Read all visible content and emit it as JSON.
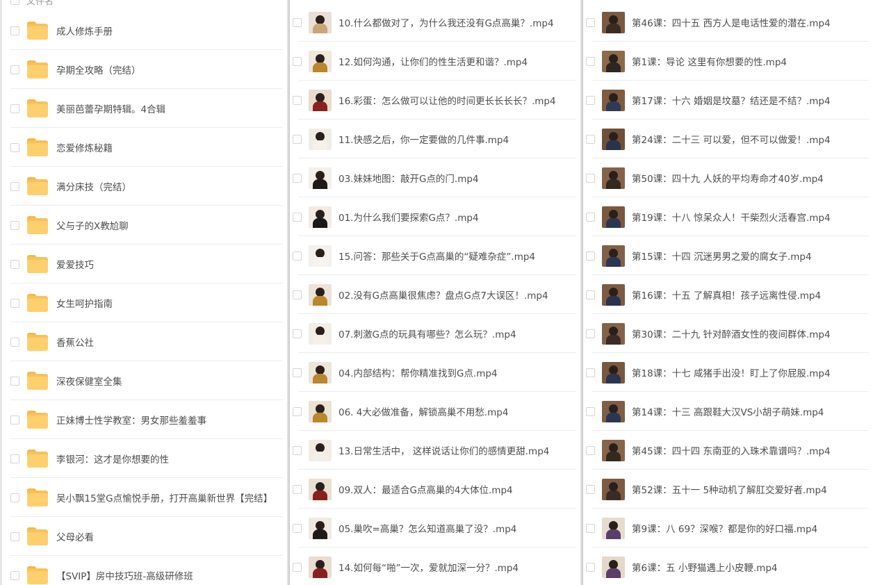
{
  "folders_header": {
    "label": "文件名"
  },
  "folders": [
    {
      "name": "成人修炼手册"
    },
    {
      "name": "孕期全攻略（完结）"
    },
    {
      "name": "美丽芭蕾孕期特辑。4合辑"
    },
    {
      "name": "恋爱修炼秘籍"
    },
    {
      "name": "满分床技（完结）"
    },
    {
      "name": "父与子的X教尬聊"
    },
    {
      "name": "爱爱技巧"
    },
    {
      "name": "女生呵护指南"
    },
    {
      "name": "香蕉公社"
    },
    {
      "name": "深夜保健室全集"
    },
    {
      "name": "正妹博士性学教室：男女那些羞羞事"
    },
    {
      "name": "李银河：这才是你想要的性"
    },
    {
      "name": "吴小飘15堂G点愉悦手册，打开高巢新世界【完结】"
    },
    {
      "name": "父母必看"
    },
    {
      "name": "【SVIP】房中技巧班-高级研修班"
    }
  ],
  "files_middle": [
    {
      "name": "10.什么都做对了，为什么我还没有G点高巢？.mp4",
      "thumb_bg": "#e9dfd6",
      "thumb_shirt": "#c9a57a"
    },
    {
      "name": "12.如何沟通，让你们的性生活更和谐？.mp4",
      "thumb_bg": "#efe6dc",
      "thumb_shirt": "#b8872e"
    },
    {
      "name": "16.彩蛋：怎么做可以让他的时间更长长长长？.mp4",
      "thumb_bg": "#e8dccf",
      "thumb_shirt": "#8a1f1f"
    },
    {
      "name": "11.快感之后，你一定要做的几件事.mp4",
      "thumb_bg": "#f2ece6",
      "thumb_shirt": "#f5f0ea"
    },
    {
      "name": "03.妹妹地图：敲开G点的门.mp4",
      "thumb_bg": "#f3efea",
      "thumb_shirt": "#1f1a17"
    },
    {
      "name": "01.为什么我们要探索G点？.mp4",
      "thumb_bg": "#f1ebe4",
      "thumb_shirt": "#1c1816"
    },
    {
      "name": "15.问答：那些关于G点高巢的“疑难杂症”.mp4",
      "thumb_bg": "#f4f0ec",
      "thumb_shirt": "#f7f3ee"
    },
    {
      "name": "02.没有G点高巢很焦虑？盘点G点7大误区！.mp4",
      "thumb_bg": "#ece3d8",
      "thumb_shirt": "#b8872e"
    },
    {
      "name": "07.刺激G点的玩具有哪些？怎么玩？.mp4",
      "thumb_bg": "#f2ede7",
      "thumb_shirt": "#f5f0ea"
    },
    {
      "name": "04.内部结构：帮你精准找到G点.mp4",
      "thumb_bg": "#ede4da",
      "thumb_shirt": "#b8872e"
    },
    {
      "name": "06. 4大必做准备，解锁高巢不用愁.mp4",
      "thumb_bg": "#ebe1d5",
      "thumb_shirt": "#b8872e"
    },
    {
      "name": "13.日常生活中， 这样说话让你们的感情更甜.mp4",
      "thumb_bg": "#f2ece5",
      "thumb_shirt": "#f3eee8"
    },
    {
      "name": "09.双人：最适合G点高巢的4大体位.mp4",
      "thumb_bg": "#eadfd3",
      "thumb_shirt": "#8a1f1f"
    },
    {
      "name": "05.巢吹=高巢？怎么知道高巢了没？.mp4",
      "thumb_bg": "#f0eae3",
      "thumb_shirt": "#1f1a17"
    },
    {
      "name": "14.如何每“啪”一次，爱就加深一分？.mp4",
      "thumb_bg": "#e8ddd1",
      "thumb_shirt": "#8a1f1f"
    }
  ],
  "files_right": [
    {
      "name": "第46课：四十五 西方人是电话性爱的潜在.mp4",
      "thumb_bg": "#7a5a40",
      "thumb_shirt": "#3a2c25"
    },
    {
      "name": "第1课：导论 这里有你想要的性.mp4",
      "thumb_bg": "#8c6a4a",
      "thumb_shirt": "#2e2622"
    },
    {
      "name": "第17课：十六 婚姻是坟墓？结还是不结？.mp4",
      "thumb_bg": "#7d5c42",
      "thumb_shirt": "#2f3a55"
    },
    {
      "name": "第24课：二十三 可以爱，但不可以做爱！.mp4",
      "thumb_bg": "#6e5039",
      "thumb_shirt": "#2a334a"
    },
    {
      "name": "第50课：四十九 人妖的平均寿命才40岁.mp4",
      "thumb_bg": "#85634a",
      "thumb_shirt": "#33291f"
    },
    {
      "name": "第19课：十八 惊呆众人！干柴烈火活春宫.mp4",
      "thumb_bg": "#7a5840",
      "thumb_shirt": "#2b3550"
    },
    {
      "name": "第15课：十四 沉迷男男之爱的腐女子.mp4",
      "thumb_bg": "#806048",
      "thumb_shirt": "#2c3651"
    },
    {
      "name": "第16课：十五 了解真相！孩子远离性侵.mp4",
      "thumb_bg": "#7b5b43",
      "thumb_shirt": "#2a334e"
    },
    {
      "name": "第30课：二十九 针对醉酒女性的夜间群体.mp4",
      "thumb_bg": "#83624a",
      "thumb_shirt": "#3a2c25"
    },
    {
      "name": "第18课：十七 咸猪手出没！盯上了你屁股.mp4",
      "thumb_bg": "#785840",
      "thumb_shirt": "#2b3550"
    },
    {
      "name": "第14课：十三 高跟鞋大汉VS小胡子萌妹.mp4",
      "thumb_bg": "#7e5e45",
      "thumb_shirt": "#2c3651"
    },
    {
      "name": "第45课：四十四 东南亚的入珠术靠谱吗？.mp4",
      "thumb_bg": "#86654b",
      "thumb_shirt": "#33291f"
    },
    {
      "name": "第52课：五十一 5种动机了解肛交爱好者.mp4",
      "thumb_bg": "#7c5b42",
      "thumb_shirt": "#3a2c25"
    },
    {
      "name": "第9课：八 69？深喉？都是你的好口福.mp4",
      "thumb_bg": "#e6dccd",
      "thumb_shirt": "#5a3e6a"
    },
    {
      "name": "第6课：五 小野猫遇上小皮鞭.mp4",
      "thumb_bg": "#e3d8c9",
      "thumb_shirt": "#5a3e6a"
    }
  ]
}
